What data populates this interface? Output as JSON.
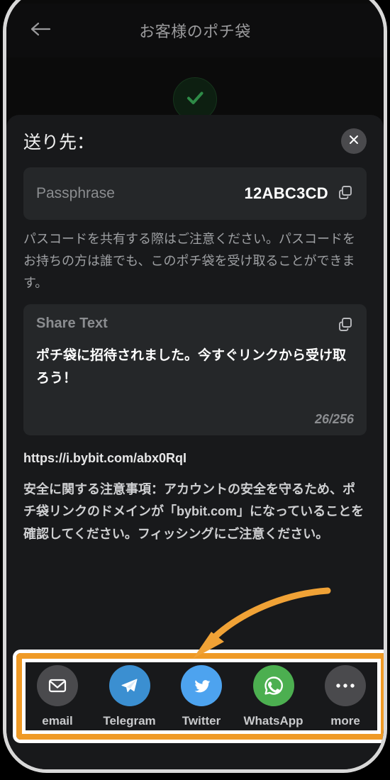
{
  "navbar": {
    "back_icon": "arrow-left-icon",
    "title": "お客様のポチ袋"
  },
  "status": {
    "icon": "check-circle-icon",
    "color": "#2e8b47"
  },
  "sheet": {
    "title": "送り先：",
    "close_icon": "close-icon",
    "passphrase": {
      "label": "Passphrase",
      "value": "12ABC3CD",
      "copy_icon": "copy-icon"
    },
    "passcode_note": "パスコードを共有する際はご注意ください。パスコードをお持ちの方は誰でも、このポチ袋を受け取ることができます。",
    "share_text": {
      "label": "Share Text",
      "copy_icon": "copy-icon",
      "value": "ポチ袋に招待されました。今すぐリンクから受け取ろう！",
      "counter": "26/256"
    },
    "link": "https://i.bybit.com/abx0RqI",
    "security_note": "安全に関する注意事項：アカウントの安全を守るため、ポチ袋リンクのドメインが「bybit.com」になっていることを確認してください。フィッシングにご注意ください。"
  },
  "share_targets": [
    {
      "label": "email",
      "icon": "envelope-icon",
      "bg": "#4a4a4d"
    },
    {
      "label": "Telegram",
      "icon": "telegram-icon",
      "bg": "#3b8fd1"
    },
    {
      "label": "Twitter",
      "icon": "twitter-icon",
      "bg": "#4da3ef"
    },
    {
      "label": "WhatsApp",
      "icon": "whatsapp-icon",
      "bg": "#4caf50"
    },
    {
      "label": "more",
      "icon": "ellipsis-icon",
      "bg": "#4a4a4d"
    }
  ],
  "annotation": {
    "arrow_icon": "curved-arrow-icon",
    "arrow_color": "#f0a236",
    "highlight_color": "#ef9a26"
  }
}
